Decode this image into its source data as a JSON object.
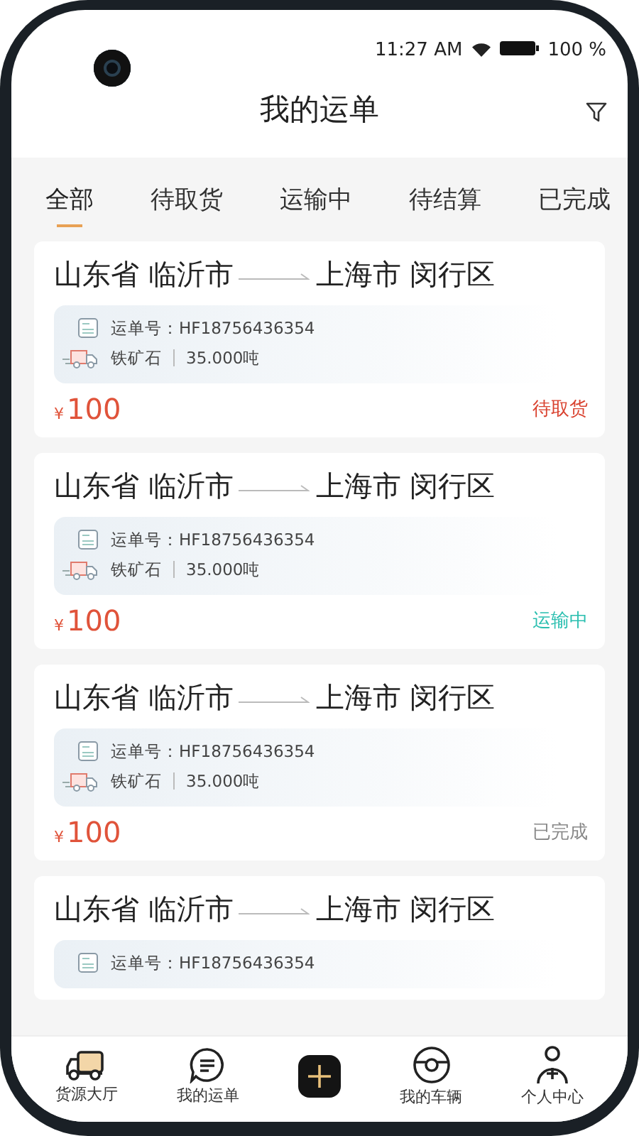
{
  "status_bar": {
    "time": "11:27 AM",
    "battery": "100 %"
  },
  "header": {
    "title": "我的运单"
  },
  "tabs": [
    {
      "label": "全部",
      "selected": true
    },
    {
      "label": "待取货",
      "selected": false
    },
    {
      "label": "运输中",
      "selected": false
    },
    {
      "label": "待结算",
      "selected": false
    },
    {
      "label": "已完成",
      "selected": false
    }
  ],
  "orders": [
    {
      "from": "山东省 临沂市",
      "to": "上海市 闵行区",
      "waybill_label": "运单号：",
      "waybill": "HF18756436354",
      "cargo": "铁矿石",
      "weight": "35.000吨",
      "currency": "¥",
      "price": "100",
      "status": "待取货",
      "color": "#d9412e"
    },
    {
      "from": "山东省 临沂市",
      "to": "上海市 闵行区",
      "waybill_label": "运单号：",
      "waybill": "HF18756436354",
      "cargo": "铁矿石",
      "weight": "35.000吨",
      "currency": "¥",
      "price": "100",
      "status": "运输中",
      "color": "#2bbfb0"
    },
    {
      "from": "山东省 临沂市",
      "to": "上海市 闵行区",
      "waybill_label": "运单号：",
      "waybill": "HF18756436354",
      "cargo": "铁矿石",
      "weight": "35.000吨",
      "currency": "¥",
      "price": "100",
      "status": "已完成",
      "color": "#888888"
    },
    {
      "from": "山东省 临沂市",
      "to": "上海市 闵行区",
      "waybill_label": "运单号：",
      "waybill": "HF18756436354"
    }
  ],
  "nav": [
    {
      "kind": "truck",
      "label": "货源大厅"
    },
    {
      "kind": "list",
      "label": "我的运单"
    },
    {
      "kind": "plus"
    },
    {
      "kind": "wheel",
      "label": "我的车辆"
    },
    {
      "kind": "person",
      "label": "个人中心"
    }
  ]
}
